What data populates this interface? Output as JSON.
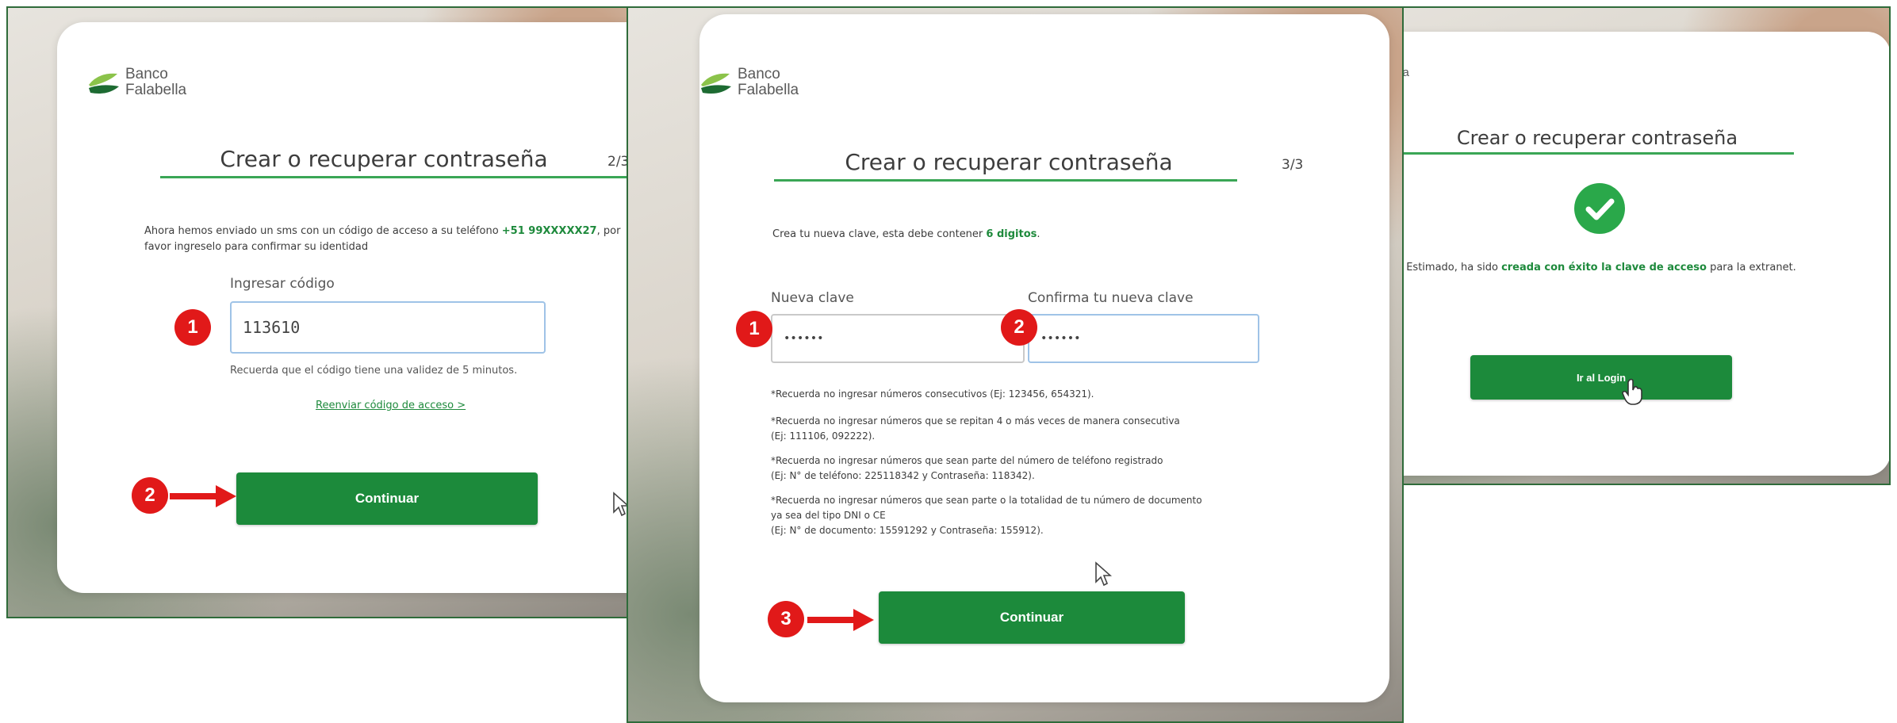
{
  "brand": {
    "line1": "Banco",
    "line2": "Falabella"
  },
  "panel1": {
    "title": "Crear o recuperar contraseña",
    "step": "2/3",
    "message_pre": "Ahora hemos enviado un sms con un código de acceso a su teléfono ",
    "phone": "+51 99XXXXX27",
    "message_post": ", por favor ingreselo para confirmar su identidad",
    "code_label": "Ingresar código",
    "code_value": "113610",
    "validity_note": "Recuerda que el código tiene una validez de 5 minutos.",
    "resend_link": "Reenviar código de acceso >",
    "continue_button": "Continuar",
    "badge_1": "1",
    "badge_2": "2"
  },
  "panel2": {
    "title": "Crear o recuperar contraseña",
    "step": "3/3",
    "intro_pre": "Crea tu nueva clave, esta debe contener ",
    "intro_digits": "6 digitos",
    "intro_post": ".",
    "new_label": "Nueva clave",
    "new_value": "••••••",
    "confirm_label": "Confirma tu nueva clave",
    "confirm_value": "••••••",
    "rule1": "*Recuerda no ingresar números consecutivos (Ej: 123456, 654321).",
    "rule2a": "*Recuerda no ingresar números que se repitan 4 o más veces de manera consecutiva",
    "rule2b": "(Ej: 111106, 092222).",
    "rule3a": "*Recuerda no ingresar números que sean parte del número de teléfono registrado",
    "rule3b": "(Ej: N° de teléfono: 225118342 y Contraseña: 118342).",
    "rule4a": "*Recuerda no ingresar números que sean parte o la totalidad de tu número de documento",
    "rule4b": "ya sea del tipo DNI o CE",
    "rule4c": "(Ej: N° de documento: 15591292 y Contraseña: 155912).",
    "continue_button": "Continuar",
    "badge_1": "1",
    "badge_2": "2",
    "badge_3": "3"
  },
  "panel3": {
    "title": "Crear o recuperar contraseña",
    "msg_pre": "Estimado, ha sido ",
    "msg_bold": "creada con éxito la clave de acceso",
    "msg_post": " para la extranet.",
    "login_button": "Ir al Login"
  },
  "colors": {
    "accent": "#1c8a3b",
    "badge": "#e11919",
    "input_border": "#9fc3e7"
  }
}
